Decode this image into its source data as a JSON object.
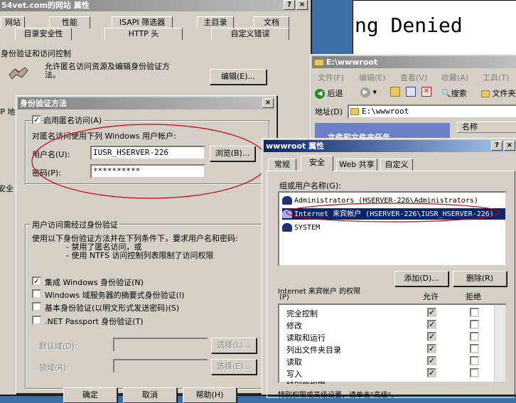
{
  "w1": {
    "title": "54vet.com的网站 属性",
    "tabs1": [
      "网站",
      "性能",
      "ISAPI 筛选器",
      "主目录",
      "文档"
    ],
    "tabs2": [
      "目录安全性",
      "HTTP 头",
      "自定义错误"
    ],
    "sec": "身份验证和访问控制",
    "desc1": "允许匿名访问资源及编辑身份验证方",
    "desc2": "法。",
    "edit": "编辑(E)...",
    "ip": "IP 地",
    "sec2": "安全"
  },
  "w2": {
    "text": "ng Denied"
  },
  "w3": {
    "title": "E:\\wwwroot",
    "menu": [
      "文件(F)",
      "编辑(E)",
      "查看(V)",
      "收藏(A)",
      "工具(T)"
    ],
    "back": "后退",
    "search": "搜索",
    "folder": "文件夹",
    "addr_label": "地址(D)",
    "addr": "E:\\wwwroot",
    "col": "名称",
    "task": "文件和文件夹任务"
  },
  "w4": {
    "title": "身份验证方法",
    "anon": "启用匿名访问(A)",
    "anon_desc": "对匿名访问使用下列 Windows 用户帐户:",
    "user_label": "用户名(U):",
    "user": "IUSR_HSERVER-226",
    "browse": "浏览(B)...",
    "pwd_label": "密码(P):",
    "pwd": "**********",
    "auth": "用户访问需经过身份验证",
    "auth_desc1": "使用以下身份验证方法并在下列条件下，要求用户名和密码:",
    "auth_desc2": "- 禁用了匿名访问，或",
    "auth_desc3": "- 使用 NTFS 访问控制列表限制了访问权限",
    "c1": "集成 Windows 身份验证(N)",
    "c2": "Windows 域服务器的摘要式身份验证(I)",
    "c3": "基本身份验证(以明文形式发送密码)(S)",
    "c4": ".NET Passport 身份验证(T)",
    "dom": "默认域(D):",
    "realm": "领域(R):",
    "sel1": "选择(L)...",
    "sel2": "选择(E)...",
    "ok": "确定",
    "cancel": "取消",
    "help": "帮助(H)"
  },
  "w5": {
    "title": "wwwroot 属性",
    "tabs": [
      "常规",
      "安全",
      "Web 共享",
      "自定义"
    ],
    "grp": "组或用户名称(G):",
    "users": [
      "Administrators (HSERVER-226\\Administrators)",
      "Internet 来宾帐户 (HSERVER-226\\IUSR_HSERVER-226)",
      "SYSTEM"
    ],
    "add": "添加(D)...",
    "del": "删除(R)",
    "perm1": "Internet 来宾帐户 的权限",
    "perm2": "(P)",
    "allow": "允许",
    "deny": "拒绝",
    "perms": [
      "完全控制",
      "修改",
      "读取和运行",
      "列出文件夹目录",
      "读取",
      "写入",
      "特别的权限"
    ],
    "footer": "特别权限或高级设置，请单击\"高级\"。"
  },
  "colors": {
    "title": "#0a246a",
    "annot": "#d00000"
  }
}
